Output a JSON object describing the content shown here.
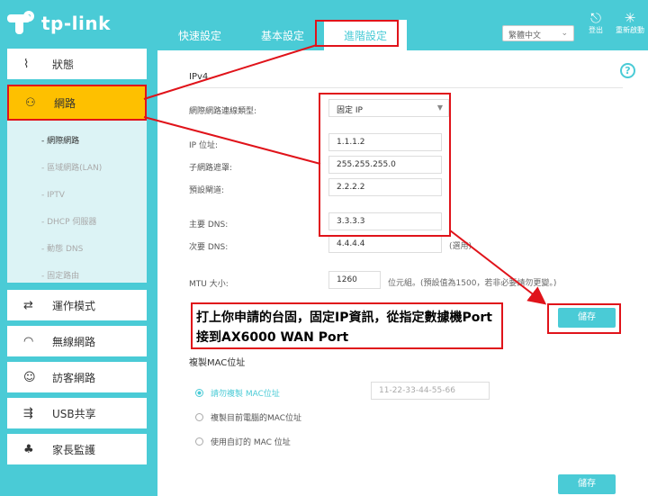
{
  "brand": "tp-link",
  "tabs": [
    "快速設定",
    "基本設定",
    "進階設定"
  ],
  "language": "繁體中文",
  "tools": {
    "logout": "登出",
    "reboot": "重新啟動"
  },
  "sidebar": {
    "items": [
      {
        "label": "狀態",
        "icon": "pulse-icon"
      },
      {
        "label": "網路",
        "icon": "network-icon"
      },
      {
        "label": "運作模式",
        "icon": "mode-icon"
      },
      {
        "label": "無線網路",
        "icon": "wifi-icon"
      },
      {
        "label": "訪客網路",
        "icon": "guest-icon"
      },
      {
        "label": "USB共享",
        "icon": "usb-icon"
      },
      {
        "label": "家長監護",
        "icon": "parental-icon"
      }
    ],
    "submenu": [
      "- 網際網路",
      "- 區域網路(LAN)",
      "- IPTV",
      "- DHCP 伺服器",
      "- 動態 DNS",
      "- 固定路由"
    ]
  },
  "main": {
    "section_title": "IPv4",
    "help": "?",
    "fields": {
      "conn_type_label": "網際網路連線類型:",
      "conn_type_value": "固定 IP",
      "ip_label": "IP 位址:",
      "ip_value": "1.1.1.2",
      "mask_label": "子網路遮罩:",
      "mask_value": "255.255.255.0",
      "gateway_label": "預設閘道:",
      "gateway_value": "2.2.2.2",
      "dns1_label": "主要 DNS:",
      "dns1_value": "3.3.3.3",
      "dns2_label": "次要 DNS:",
      "dns2_value": "4.4.4.4",
      "dns2_note": "(選用)",
      "mtu_label": "MTU 大小:",
      "mtu_value": "1260",
      "mtu_note": "位元組。(預設值為1500，若非必要請勿更變。)"
    },
    "save_label": "儲存",
    "mac_title": "複製MAC位址",
    "mac_options": [
      "請勿複製 MAC位址",
      "複製目前電腦的MAC位址",
      "使用自訂的 MAC 位址"
    ],
    "mac_value": "11-22-33-44-55-66"
  },
  "annotation": {
    "line1": "打上你申請的台固，固定IP資訊，從指定數據機Port",
    "line2": "接到AX6000 WAN Port"
  },
  "colors": {
    "accent": "#4acbd6",
    "highlight": "#fec000",
    "annotation_red": "#e0131a"
  }
}
